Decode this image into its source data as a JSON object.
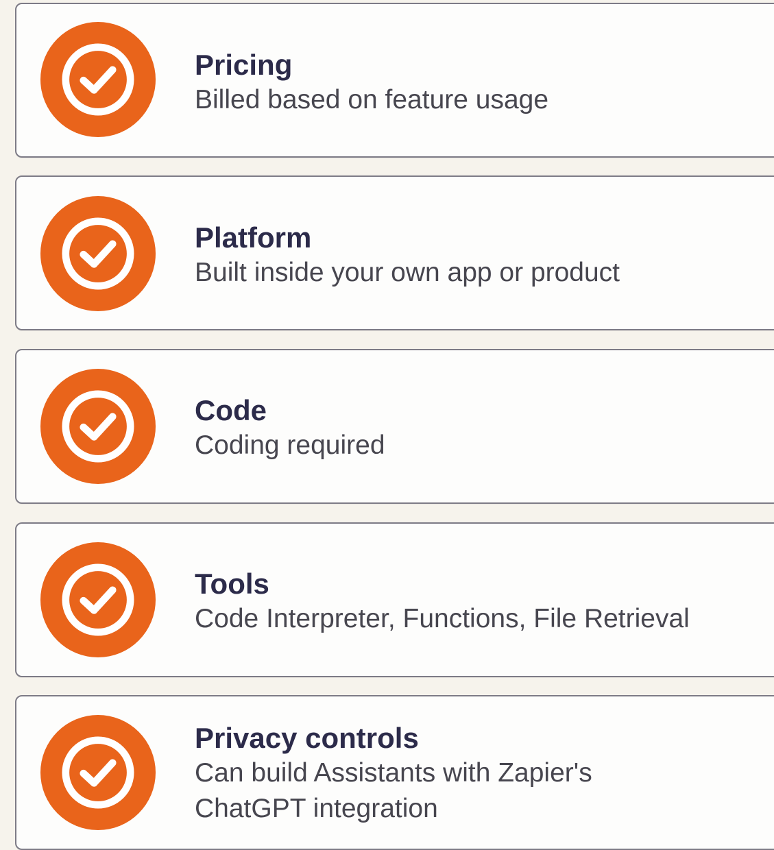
{
  "accent_color": "#e9641b",
  "features": [
    {
      "title": "Pricing",
      "description": [
        "Billed based on feature usage"
      ],
      "icon": "check-circle-icon"
    },
    {
      "title": "Platform",
      "description": [
        "Built inside your own app or product"
      ],
      "icon": "check-circle-icon"
    },
    {
      "title": "Code",
      "description": [
        "Coding required"
      ],
      "icon": "check-circle-icon"
    },
    {
      "title": "Tools",
      "description": [
        "Code Interpreter, Functions, File Retrieval"
      ],
      "icon": "check-circle-icon"
    },
    {
      "title": "Privacy controls",
      "description": [
        "Can build Assistants with Zapier's",
        "ChatGPT integration"
      ],
      "icon": "check-circle-icon"
    }
  ]
}
